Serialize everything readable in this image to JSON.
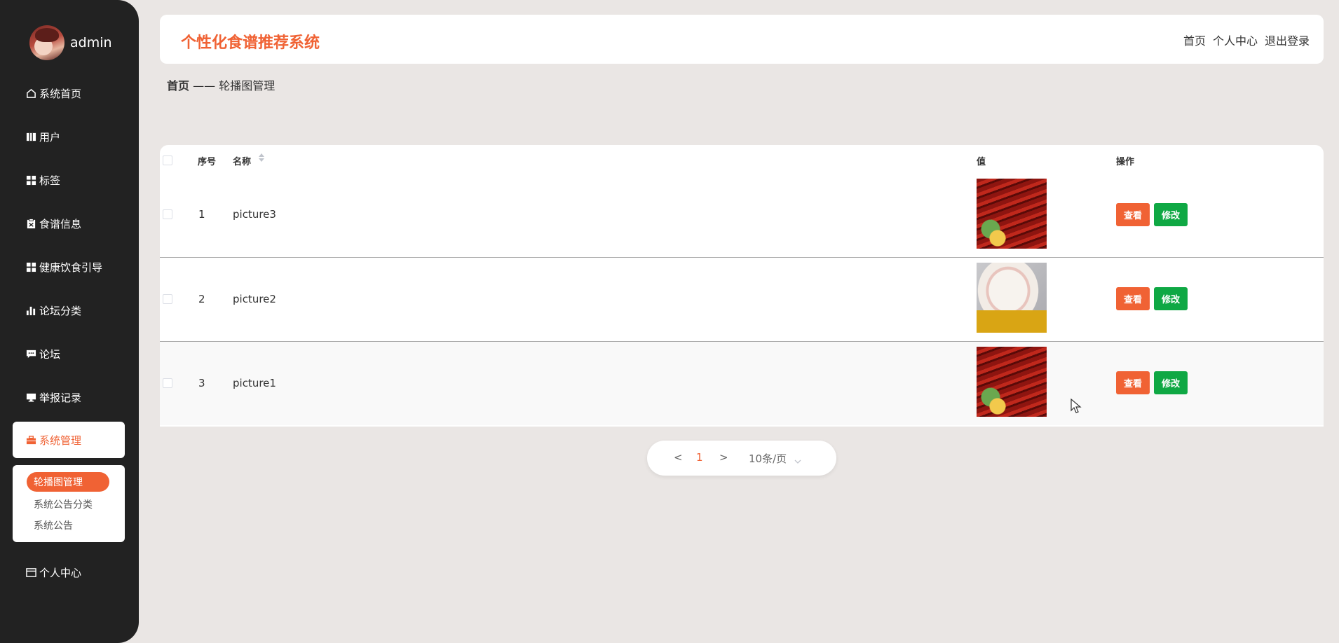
{
  "sidebar": {
    "username": "admin",
    "items": [
      {
        "label": "系统首页",
        "icon": "home-icon"
      },
      {
        "label": "用户",
        "icon": "book-icon"
      },
      {
        "label": "标签",
        "icon": "grid-icon"
      },
      {
        "label": "食谱信息",
        "icon": "clipboard-icon"
      },
      {
        "label": "健康饮食引导",
        "icon": "grid-icon"
      },
      {
        "label": "论坛分类",
        "icon": "bar-chart-icon"
      },
      {
        "label": "论坛",
        "icon": "chat-icon"
      },
      {
        "label": "举报记录",
        "icon": "monitor-icon"
      }
    ],
    "active": {
      "label": "系统管理",
      "icon": "briefcase-icon"
    },
    "submenu": [
      "轮播图管理",
      "系统公告分类",
      "系统公告"
    ],
    "bottom": {
      "label": "个人中心",
      "icon": "card-icon"
    }
  },
  "header": {
    "title": "个性化食谱推荐系统",
    "links": [
      "首页",
      "个人中心",
      "退出登录"
    ]
  },
  "breadcrumb": {
    "home": "首页",
    "separator": "——",
    "current": "轮播图管理"
  },
  "table": {
    "columns": {
      "index": "序号",
      "name": "名称",
      "value": "值",
      "actions": "操作"
    },
    "rows": [
      {
        "index": "1",
        "name": "picture3",
        "image": "lobster"
      },
      {
        "index": "2",
        "name": "picture2",
        "image": "bun"
      },
      {
        "index": "3",
        "name": "picture1",
        "image": "lobster"
      }
    ],
    "view_label": "查看",
    "edit_label": "修改"
  },
  "pagination": {
    "prev": "<",
    "page": "1",
    "next": ">",
    "page_size": "10条/页"
  },
  "colors": {
    "accent": "#f06234",
    "edit": "#0fa844",
    "sidebar": "#222222"
  }
}
